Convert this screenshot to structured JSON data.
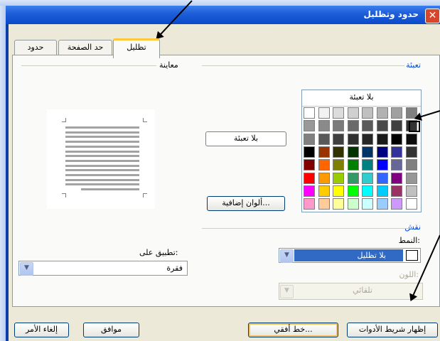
{
  "window": {
    "title": "حدود وتظليل",
    "close_glyph": "✕"
  },
  "tabs": [
    {
      "label": "تظليل"
    },
    {
      "label": "حد الصفحة"
    },
    {
      "label": "حدود"
    }
  ],
  "fill": {
    "header": "تعبئة",
    "no_fill_label": "بلا تعبئة",
    "current_label": "بلا تعبئة",
    "more_colors_label": "ألوان إضافية..."
  },
  "palette_colors": [
    [
      "#ffffff",
      "#f2f2f2",
      "#dcdcdc",
      "#d0d0d0",
      "#c0c0c0",
      "#b2b2b2",
      "#a0a0a0",
      "#808080"
    ],
    [
      "#999999",
      "#8a8a8a",
      "#7a7a7a",
      "#6a6a6a",
      "#5a5a5a",
      "#4a4a4a",
      "#404040",
      "#333333"
    ],
    [
      "#808080",
      "#595959",
      "#404040",
      "#303030",
      "#262626",
      "#1a1a1a",
      "#000000",
      "#0d0d0d"
    ],
    [
      "#000000",
      "#993300",
      "#333300",
      "#003300",
      "#003366",
      "#000080",
      "#333399",
      "#333333"
    ],
    [
      "#800000",
      "#ff6600",
      "#808000",
      "#008000",
      "#008080",
      "#0000ff",
      "#666699",
      "#808080"
    ],
    [
      "#ff0000",
      "#ff9900",
      "#99cc00",
      "#339966",
      "#33cccc",
      "#3366ff",
      "#800080",
      "#969696"
    ],
    [
      "#ff00ff",
      "#ffcc00",
      "#ffff00",
      "#00ff00",
      "#00ffff",
      "#00ccff",
      "#993366",
      "#c0c0c0"
    ],
    [
      "#ff99cc",
      "#ffcc99",
      "#ffff99",
      "#ccffcc",
      "#ccffff",
      "#99ccff",
      "#cc99ff",
      "#ffffff"
    ]
  ],
  "pattern": {
    "header": "نقش",
    "style_label": "النمط:",
    "style_value": "بلا تظليل",
    "color_label": "اللون:",
    "color_value": "تلقائي"
  },
  "preview": {
    "header": "معاينة"
  },
  "apply": {
    "label": "تطبيق على:",
    "value": "فقرة"
  },
  "buttons": {
    "show_toolbar": "إظهار شريط الأدوات",
    "horizontal_line": "خط أفقي...",
    "ok": "موافق",
    "cancel": "إلغاء الأمر"
  }
}
